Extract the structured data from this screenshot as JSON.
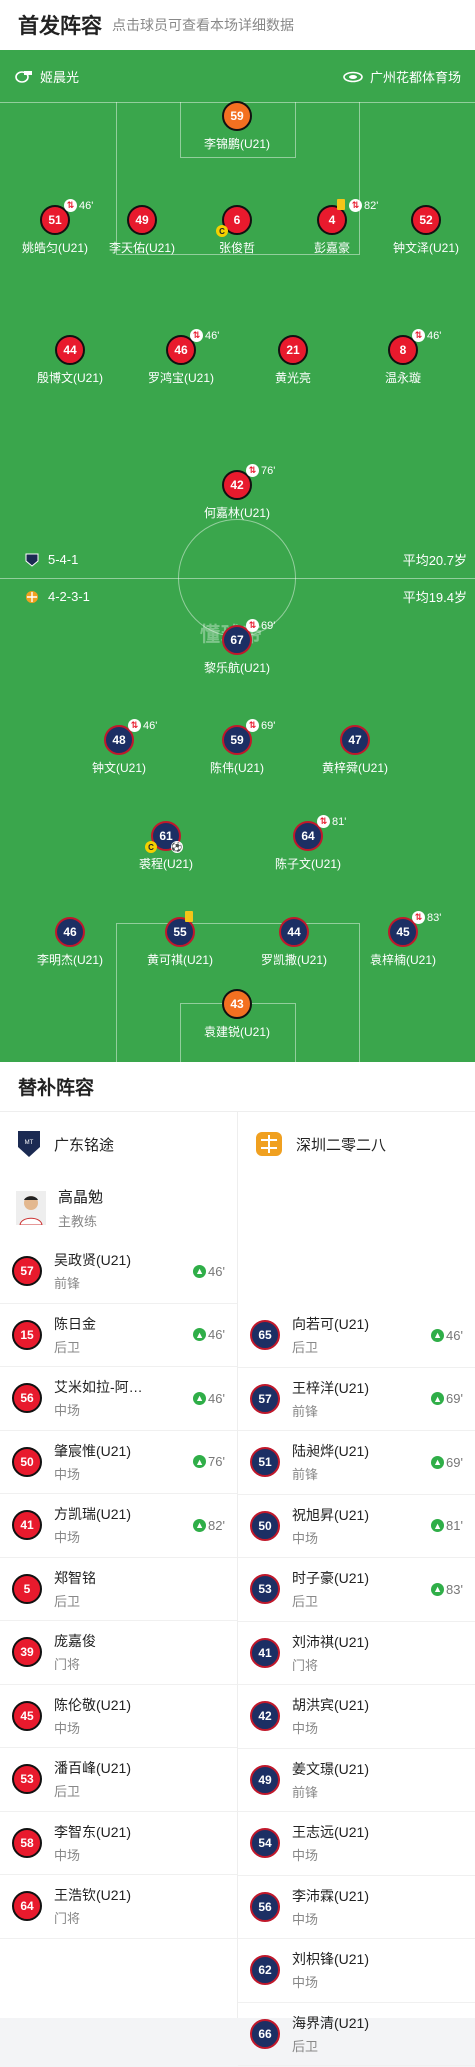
{
  "header": {
    "title": "首发阵容",
    "hint": "点击球员可查看本场详细数据"
  },
  "pitch": {
    "referee": "姬晨光",
    "stadium": "广州花都体育场",
    "watermark": "懂球帝",
    "home": {
      "formation": "5-4-1",
      "avg_age": "平均20.7岁"
    },
    "away": {
      "formation": "4-2-3-1",
      "avg_age": "平均19.4岁"
    },
    "home_players": [
      {
        "num": "59",
        "name": "李锦鹏(U21)",
        "kit": "orange"
      },
      {
        "num": "51",
        "name": "姚皓匀(U21)",
        "kit": "red",
        "sub": "46'"
      },
      {
        "num": "49",
        "name": "李天佑(U21)",
        "kit": "red"
      },
      {
        "num": "6",
        "name": "张俊哲",
        "kit": "red",
        "captain": true
      },
      {
        "num": "4",
        "name": "彭嘉豪",
        "kit": "red",
        "yellow": true,
        "sub": "82'"
      },
      {
        "num": "52",
        "name": "钟文泽(U21)",
        "kit": "red"
      },
      {
        "num": "44",
        "name": "殷博文(U21)",
        "kit": "red"
      },
      {
        "num": "46",
        "name": "罗鸿宝(U21)",
        "kit": "red",
        "sub": "46'"
      },
      {
        "num": "21",
        "name": "黄光亮",
        "kit": "red"
      },
      {
        "num": "8",
        "name": "温永璇",
        "kit": "red",
        "sub": "46'"
      },
      {
        "num": "42",
        "name": "何嘉林(U21)",
        "kit": "red",
        "sub": "76'"
      }
    ],
    "away_players": [
      {
        "num": "67",
        "name": "黎乐航(U21)",
        "kit": "navy",
        "sub": "69'"
      },
      {
        "num": "48",
        "name": "钟文(U21)",
        "kit": "navy",
        "sub": "46'"
      },
      {
        "num": "59",
        "name": "陈伟(U21)",
        "kit": "navy",
        "sub": "69'"
      },
      {
        "num": "47",
        "name": "黄梓舜(U21)",
        "kit": "navy"
      },
      {
        "num": "61",
        "name": "裘程(U21)",
        "kit": "navy",
        "captain": true,
        "goal": true
      },
      {
        "num": "64",
        "name": "陈子文(U21)",
        "kit": "navy",
        "sub": "81'"
      },
      {
        "num": "46",
        "name": "李明杰(U21)",
        "kit": "navy"
      },
      {
        "num": "55",
        "name": "黄可祺(U21)",
        "kit": "navy",
        "yellow": true
      },
      {
        "num": "44",
        "name": "罗凯撒(U21)",
        "kit": "navy"
      },
      {
        "num": "45",
        "name": "袁梓楠(U21)",
        "kit": "navy",
        "sub": "83'"
      },
      {
        "num": "43",
        "name": "袁建锐(U21)",
        "kit": "orange"
      }
    ]
  },
  "subs": {
    "title": "替补阵容",
    "home": {
      "team": "广东铭途",
      "coach": {
        "name": "高晶勉",
        "role": "主教练"
      },
      "players": [
        {
          "num": "57",
          "name": "吴政贤(U21)",
          "pos": "前锋",
          "min": "46'"
        },
        {
          "num": "15",
          "name": "陈日金",
          "pos": "后卫",
          "min": "46'"
        },
        {
          "num": "56",
          "name": "艾米如拉-阿…",
          "pos": "中场",
          "min": "46'"
        },
        {
          "num": "50",
          "name": "肇宸惟(U21)",
          "pos": "中场",
          "min": "76'"
        },
        {
          "num": "41",
          "name": "方凯瑞(U21)",
          "pos": "中场",
          "min": "82'"
        },
        {
          "num": "5",
          "name": "郑智铭",
          "pos": "后卫",
          "min": ""
        },
        {
          "num": "39",
          "name": "庞嘉俊",
          "pos": "门将",
          "min": ""
        },
        {
          "num": "45",
          "name": "陈伦敬(U21)",
          "pos": "中场",
          "min": ""
        },
        {
          "num": "53",
          "name": "潘百峰(U21)",
          "pos": "后卫",
          "min": ""
        },
        {
          "num": "58",
          "name": "李智东(U21)",
          "pos": "中场",
          "min": ""
        },
        {
          "num": "64",
          "name": "王浩钦(U21)",
          "pos": "门将",
          "min": ""
        }
      ]
    },
    "away": {
      "team": "深圳二零二八",
      "players": [
        {
          "num": "65",
          "name": "向若可(U21)",
          "pos": "后卫",
          "min": "46'"
        },
        {
          "num": "57",
          "name": "王梓洋(U21)",
          "pos": "前锋",
          "min": "69'"
        },
        {
          "num": "51",
          "name": "陆昶烨(U21)",
          "pos": "前锋",
          "min": "69'"
        },
        {
          "num": "50",
          "name": "祝旭昇(U21)",
          "pos": "中场",
          "min": "81'"
        },
        {
          "num": "53",
          "name": "时子豪(U21)",
          "pos": "后卫",
          "min": "83'"
        },
        {
          "num": "41",
          "name": "刘沛祺(U21)",
          "pos": "门将",
          "min": ""
        },
        {
          "num": "42",
          "name": "胡洪宾(U21)",
          "pos": "中场",
          "min": ""
        },
        {
          "num": "49",
          "name": "姜文璟(U21)",
          "pos": "前锋",
          "min": ""
        },
        {
          "num": "54",
          "name": "王志远(U21)",
          "pos": "中场",
          "min": ""
        },
        {
          "num": "56",
          "name": "李沛霖(U21)",
          "pos": "中场",
          "min": ""
        },
        {
          "num": "62",
          "name": "刘枳锋(U21)",
          "pos": "中场",
          "min": ""
        },
        {
          "num": "66",
          "name": "海界清(U21)",
          "pos": "后卫",
          "min": ""
        }
      ]
    }
  }
}
